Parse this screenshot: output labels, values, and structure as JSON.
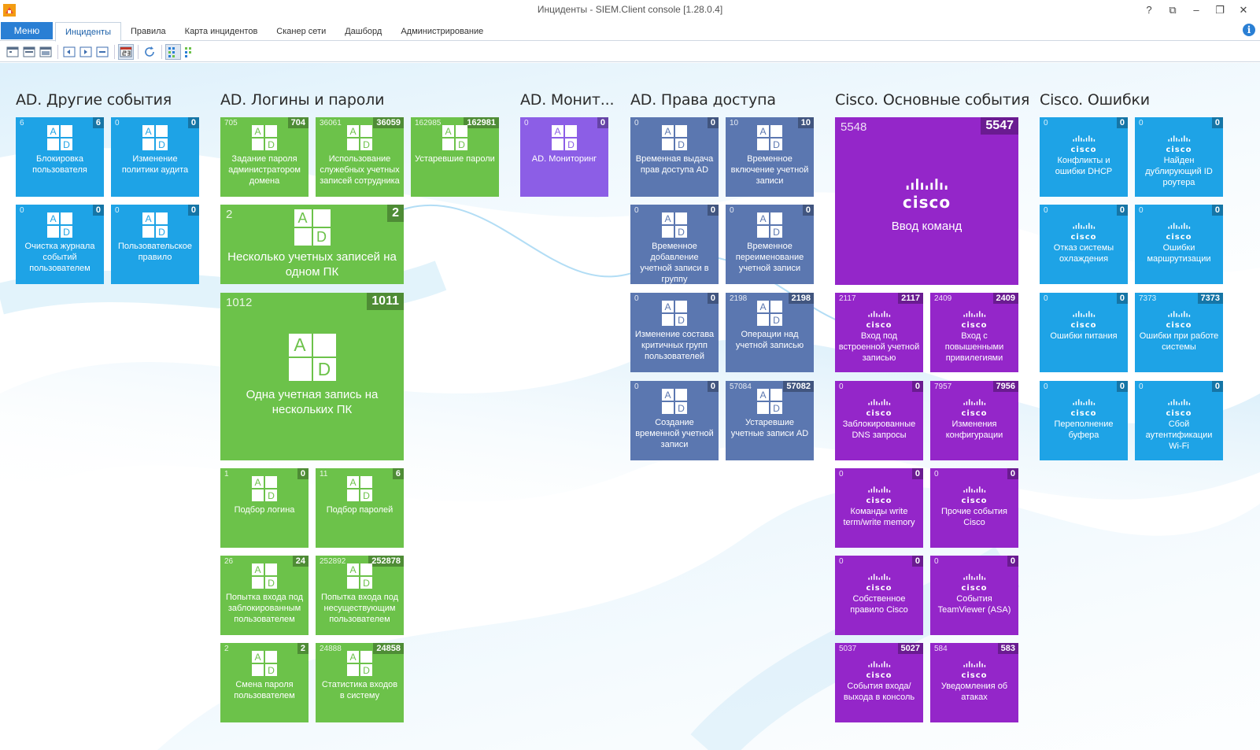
{
  "window": {
    "title": "Инциденты - SIEM.Client console [1.28.0.4]",
    "buttons": [
      "?",
      "⧉",
      "–",
      "❐",
      "✕"
    ]
  },
  "menu": {
    "menu_button": "Меню",
    "items": [
      "Инциденты",
      "Правила",
      "Карта инцидентов",
      "Сканер сети",
      "Дашборд",
      "Администрирование"
    ],
    "active": "Инциденты",
    "info": "i"
  },
  "colors": {
    "blue": "#1ea3e6",
    "green": "#6cc24a",
    "violet": "#8c5ee6",
    "slate": "#5b77b0",
    "purple": "#9426c9"
  },
  "groups": [
    {
      "title": "AD. Другие события",
      "tiles": [
        {
          "left": "6",
          "right": "6",
          "label": "Блокировка пользователя",
          "icon": "ad-icon"
        },
        {
          "left": "0",
          "right": "0",
          "label": "Изменение политики аудита",
          "icon": "ad-icon"
        },
        {
          "left": "0",
          "right": "0",
          "label": "Очистка журнала событий пользователем",
          "icon": "ad-icon"
        },
        {
          "left": "0",
          "right": "0",
          "label": "Пользовательское правило",
          "icon": "ad-icon"
        }
      ]
    },
    {
      "title": "AD. Логины и пароли",
      "tiles": [
        {
          "left": "705",
          "right": "704",
          "label": "Задание пароля администратором домена",
          "icon": "ad-icon"
        },
        {
          "left": "36061",
          "right": "36059",
          "label": "Использование служебных учетных записей сотрудника",
          "icon": "ad-icon"
        },
        {
          "left": "162985",
          "right": "162981",
          "label": "Устаревшие пароли",
          "icon": "ad-icon"
        },
        {
          "left": "2",
          "right": "2",
          "label": "Несколько учетных записей на одном ПК",
          "icon": "ad-icon"
        },
        {
          "left": "1012",
          "right": "1011",
          "label": "Одна учетная запись на нескольких ПК",
          "icon": "ad-icon"
        },
        {
          "left": "1",
          "right": "0",
          "label": "Подбор логина",
          "icon": "ad-icon"
        },
        {
          "left": "11",
          "right": "6",
          "label": "Подбор паролей",
          "icon": "ad-icon"
        },
        {
          "left": "26",
          "right": "24",
          "label": "Попытка входа под заблокированным пользователем",
          "icon": "ad-icon"
        },
        {
          "left": "252892",
          "right": "252878",
          "label": "Попытка входа под несуществующим пользователем",
          "icon": "ad-icon"
        },
        {
          "left": "2",
          "right": "2",
          "label": "Смена пароля пользователем",
          "icon": "ad-icon"
        },
        {
          "left": "24888",
          "right": "24858",
          "label": "Статистика входов в систему",
          "icon": "ad-icon"
        }
      ]
    },
    {
      "title": "AD. Монит...",
      "tiles": [
        {
          "left": "0",
          "right": "0",
          "label": "AD. Мониторинг",
          "icon": "ad-icon"
        }
      ]
    },
    {
      "title": "AD. Права доступа",
      "tiles": [
        {
          "left": "0",
          "right": "0",
          "label": "Временная выдача прав доступа AD",
          "icon": "ad-icon"
        },
        {
          "left": "10",
          "right": "10",
          "label": "Временное включение учетной записи",
          "icon": "ad-icon"
        },
        {
          "left": "0",
          "right": "0",
          "label": "Временное добавление учетной записи в группу",
          "icon": "ad-icon"
        },
        {
          "left": "0",
          "right": "0",
          "label": "Временное переименование учетной записи",
          "icon": "ad-icon"
        },
        {
          "left": "0",
          "right": "0",
          "label": "Изменение состава критичных групп пользователей",
          "icon": "ad-icon"
        },
        {
          "left": "2198",
          "right": "2198",
          "label": "Операции над учетной записью",
          "icon": "ad-icon"
        },
        {
          "left": "0",
          "right": "0",
          "label": "Создание временной учетной записи",
          "icon": "ad-icon"
        },
        {
          "left": "57084",
          "right": "57082",
          "label": "Устаревшие учетные записи AD",
          "icon": "ad-icon"
        }
      ]
    },
    {
      "title": "Cisco. Основные события",
      "tiles": [
        {
          "left": "5548",
          "right": "5547",
          "label": "Ввод команд",
          "icon": "cisco-icon"
        },
        {
          "left": "2117",
          "right": "2117",
          "label": "Вход под встроенной учетной записью",
          "icon": "cisco-icon"
        },
        {
          "left": "2409",
          "right": "2409",
          "label": "Вход с повышенными привилегиями",
          "icon": "cisco-icon"
        },
        {
          "left": "0",
          "right": "0",
          "label": "Заблокированные DNS запросы",
          "icon": "cisco-icon"
        },
        {
          "left": "7957",
          "right": "7956",
          "label": "Изменения конфигурации",
          "icon": "cisco-icon"
        },
        {
          "left": "0",
          "right": "0",
          "label": "Команды write term/write memory",
          "icon": "cisco-icon"
        },
        {
          "left": "0",
          "right": "0",
          "label": "Прочие события Cisco",
          "icon": "cisco-icon"
        },
        {
          "left": "0",
          "right": "0",
          "label": "Собственное правило Cisco",
          "icon": "cisco-icon"
        },
        {
          "left": "0",
          "right": "0",
          "label": "События TeamViewer (ASA)",
          "icon": "cisco-icon"
        },
        {
          "left": "5037",
          "right": "5027",
          "label": "События входа/выхода в консоль",
          "icon": "cisco-icon"
        },
        {
          "left": "584",
          "right": "583",
          "label": "Уведомления об атаках",
          "icon": "cisco-icon"
        }
      ]
    },
    {
      "title": "Cisco. Ошибки",
      "tiles": [
        {
          "left": "0",
          "right": "0",
          "label": "Конфликты и ошибки DHCP",
          "icon": "cisco-icon"
        },
        {
          "left": "0",
          "right": "0",
          "label": "Найден дублирующий ID роутера",
          "icon": "cisco-icon"
        },
        {
          "left": "0",
          "right": "0",
          "label": "Отказ системы охлаждения",
          "icon": "cisco-icon"
        },
        {
          "left": "0",
          "right": "0",
          "label": "Ошибки маршрутизации",
          "icon": "cisco-icon"
        },
        {
          "left": "0",
          "right": "0",
          "label": "Ошибки питания",
          "icon": "cisco-icon"
        },
        {
          "left": "7373",
          "right": "7373",
          "label": "Ошибки при работе системы",
          "icon": "cisco-icon"
        },
        {
          "left": "0",
          "right": "0",
          "label": "Переполнение буфера",
          "icon": "cisco-icon"
        },
        {
          "left": "0",
          "right": "0",
          "label": "Сбой аутентификации Wi-Fi",
          "icon": "cisco-icon"
        }
      ]
    }
  ],
  "icon_text": {
    "a": "A",
    "d": "D",
    "cisco": "cisco"
  }
}
